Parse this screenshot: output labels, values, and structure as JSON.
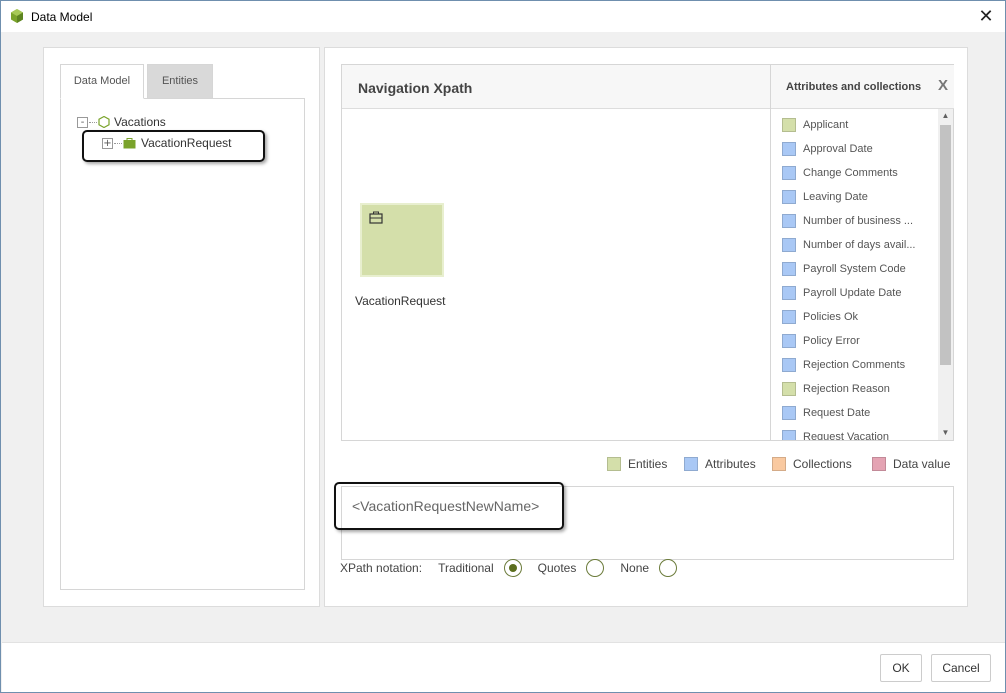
{
  "window": {
    "title": "Data Model",
    "close_glyph": "✕"
  },
  "left": {
    "tabs": [
      {
        "label": "Data Model",
        "active": true
      },
      {
        "label": "Entities",
        "active": false
      }
    ],
    "tree": {
      "root": {
        "label": "Vacations",
        "expander": "-",
        "icon": "hexagon-icon"
      },
      "child": {
        "label": "VacationRequest",
        "expander": "+",
        "icon": "entity-icon"
      }
    }
  },
  "nav": {
    "title": "Navigation Xpath",
    "node": {
      "label": "VacationRequest",
      "icon": "entity-icon"
    }
  },
  "attributes": {
    "title": "Attributes and collections",
    "close_label": "X",
    "items": [
      {
        "label": "Applicant",
        "kind": "entity"
      },
      {
        "label": "Approval Date",
        "kind": "attribute"
      },
      {
        "label": "Change Comments",
        "kind": "attribute"
      },
      {
        "label": "Leaving Date",
        "kind": "attribute"
      },
      {
        "label": "Number of business ...",
        "kind": "attribute"
      },
      {
        "label": "Number of days avail...",
        "kind": "attribute"
      },
      {
        "label": "Payroll System Code",
        "kind": "attribute"
      },
      {
        "label": "Payroll Update Date",
        "kind": "attribute"
      },
      {
        "label": "Policies Ok",
        "kind": "attribute"
      },
      {
        "label": "Policy Error",
        "kind": "attribute"
      },
      {
        "label": "Rejection Comments",
        "kind": "attribute"
      },
      {
        "label": "Rejection Reason",
        "kind": "entity"
      },
      {
        "label": "Request Date",
        "kind": "attribute"
      },
      {
        "label": "Request Vacation",
        "kind": "attribute"
      }
    ]
  },
  "legend": [
    {
      "label": "Entities",
      "color": "#d4dfaa"
    },
    {
      "label": "Attributes",
      "color": "#a9c8f5"
    },
    {
      "label": "Collections",
      "color": "#f9c9a0"
    },
    {
      "label": "Data value",
      "color": "#e4a3b3"
    }
  ],
  "colors": {
    "entity": "#d4dfaa",
    "attribute": "#a9c8f5"
  },
  "xpath": {
    "value": "<VacationRequestNewName>"
  },
  "notation": {
    "label": "XPath notation:",
    "options": [
      {
        "label": "Traditional",
        "checked": true
      },
      {
        "label": "Quotes",
        "checked": false
      },
      {
        "label": "None",
        "checked": false
      }
    ]
  },
  "footer": {
    "ok_label": "OK",
    "cancel_label": "Cancel"
  }
}
